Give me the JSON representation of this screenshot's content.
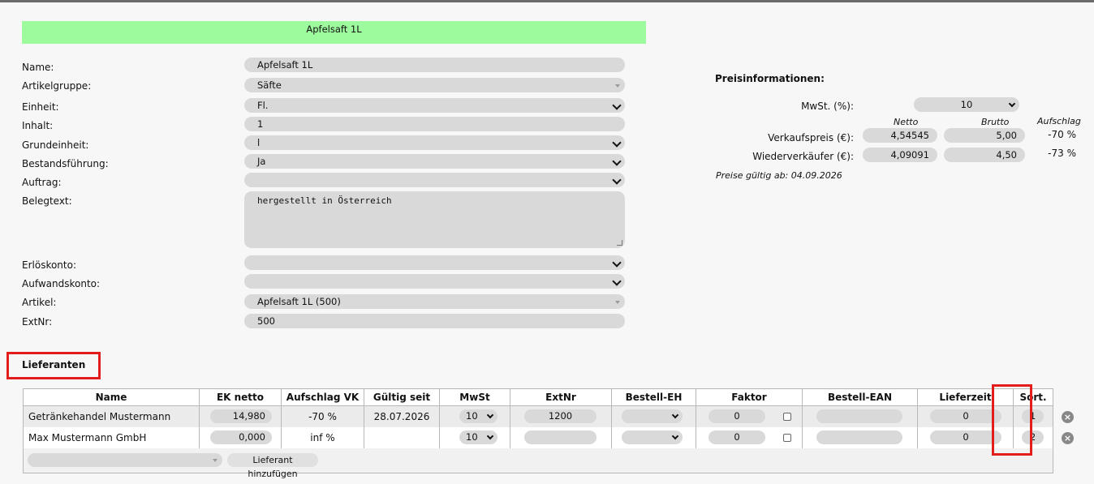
{
  "title": "Apfelsaft 1L",
  "form": {
    "name": {
      "label": "Name:",
      "value": "Apfelsaft 1L"
    },
    "artikelgruppe": {
      "label": "Artikelgruppe:",
      "value": "Säfte"
    },
    "einheit": {
      "label": "Einheit:",
      "value": "Fl."
    },
    "inhalt": {
      "label": "Inhalt:",
      "value": "1"
    },
    "grundeinheit": {
      "label": "Grundeinheit:",
      "value": "l"
    },
    "bestandsfuehrung": {
      "label": "Bestandsführung:",
      "value": "Ja"
    },
    "auftrag": {
      "label": "Auftrag:",
      "value": ""
    },
    "belegtext": {
      "label": "Belegtext:",
      "value": "hergestellt in Österreich"
    },
    "erloeskonto": {
      "label": "Erlöskonto:",
      "value": ""
    },
    "aufwandskonto": {
      "label": "Aufwandskonto:",
      "value": ""
    },
    "artikel": {
      "label": "Artikel:",
      "value": "Apfelsaft 1L (500)"
    },
    "extnr": {
      "label": "ExtNr:",
      "value": "500"
    }
  },
  "prices": {
    "title": "Preisinformationen:",
    "mwst_label": "MwSt. (%):",
    "mwst_value": "10",
    "col_netto": "Netto",
    "col_brutto": "Brutto",
    "col_aufschlag": "Aufschlag",
    "verkauf": {
      "label": "Verkaufspreis (€):",
      "netto": "4,54545",
      "brutto": "5,00",
      "aufschlag": "-70 %"
    },
    "wieder": {
      "label": "Wiederverkäufer (€):",
      "netto": "4,09091",
      "brutto": "4,50",
      "aufschlag": "-73 %"
    },
    "valid": "Preise gültig ab: 04.09.2026"
  },
  "suppliers": {
    "section_title": "Lieferanten",
    "headers": [
      "Name",
      "EK netto",
      "Aufschlag VK",
      "Gültig seit",
      "MwSt",
      "ExtNr",
      "Bestell-EH",
      "Faktor",
      "Bestell-EAN",
      "Lieferzeit",
      "Sort."
    ],
    "rows": [
      {
        "name": "Getränkehandel Mustermann",
        "ek": "14,980",
        "aufschlag": "-70 %",
        "gueltig": "28.07.2026",
        "mwst": "10",
        "extnr": "1200",
        "bestell_eh": "",
        "faktor": "0",
        "ean": "",
        "lieferzeit": "0",
        "sort": "1"
      },
      {
        "name": "Max Mustermann GmbH",
        "ek": "0,000",
        "aufschlag": "inf %",
        "gueltig": "",
        "mwst": "10",
        "extnr": "",
        "bestell_eh": "",
        "faktor": "0",
        "ean": "",
        "lieferzeit": "0",
        "sort": "2"
      }
    ],
    "add_button": "Lieferant hinzufügen",
    "add_select_value": ""
  },
  "colors": {
    "title_bg": "#9dfa9d",
    "highlight": "#e31c1c",
    "field_bg": "#d9d9d9"
  }
}
